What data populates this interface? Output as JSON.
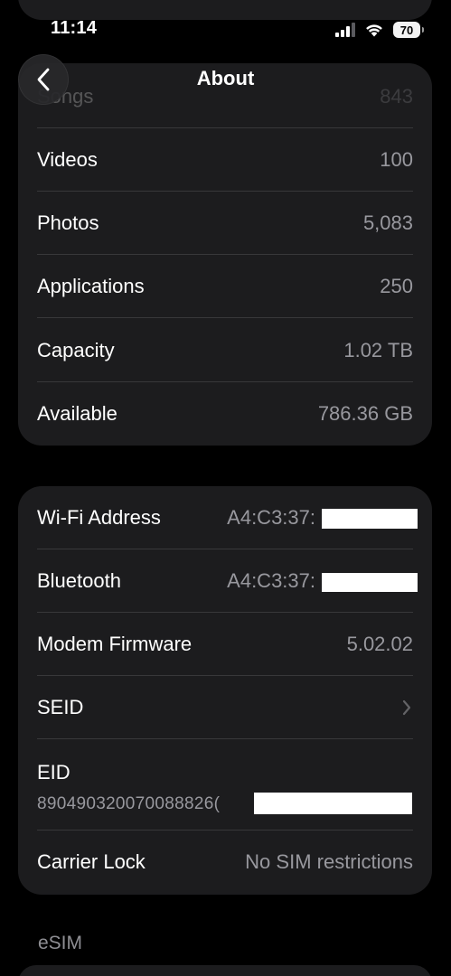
{
  "status_bar": {
    "time": "11:14",
    "battery": "70"
  },
  "nav": {
    "title": "About",
    "back_icon": "chevron-left-icon"
  },
  "media_card": {
    "rows": [
      {
        "label": "Songs",
        "value": "843"
      },
      {
        "label": "Videos",
        "value": "100"
      },
      {
        "label": "Photos",
        "value": "5,083"
      },
      {
        "label": "Applications",
        "value": "250"
      },
      {
        "label": "Capacity",
        "value": "1.02 TB"
      },
      {
        "label": "Available",
        "value": "786.36 GB"
      }
    ]
  },
  "network_card": {
    "wifi": {
      "label": "Wi-Fi Address",
      "value": "A4:C3:37:"
    },
    "bluetooth": {
      "label": "Bluetooth",
      "value": "A4:C3:37:"
    },
    "modem": {
      "label": "Modem Firmware",
      "value": "5.02.02"
    },
    "seid": {
      "label": "SEID"
    },
    "eid": {
      "label": "EID",
      "value": "890490320070088826("
    },
    "carrier": {
      "label": "Carrier Lock",
      "value": "No SIM restrictions"
    }
  },
  "esim": {
    "header": "eSIM"
  },
  "colors": {
    "background": "#000000",
    "card": "#1c1c1e",
    "separator": "#38383a",
    "secondary_text": "#98989e"
  }
}
